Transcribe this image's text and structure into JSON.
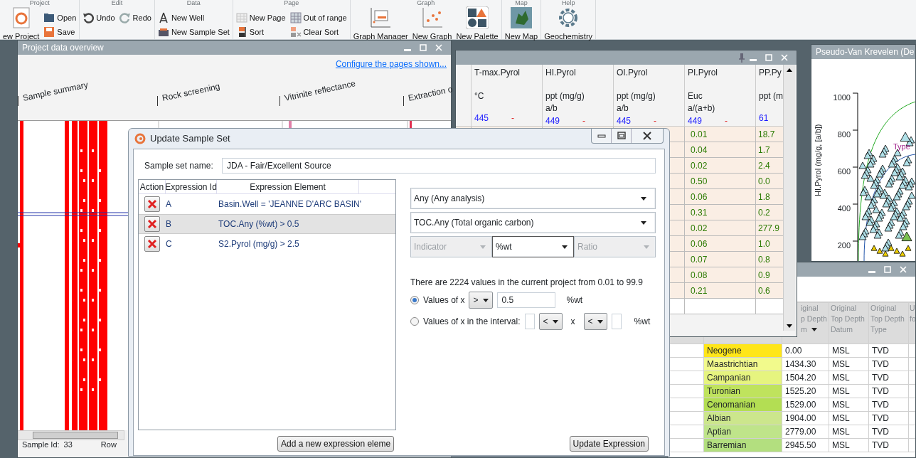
{
  "ribbon": {
    "groups": [
      {
        "label": "Project",
        "columns": [
          [
            {
              "label": "ew Project",
              "kind": "large"
            }
          ],
          [
            {
              "label": "Open",
              "kind": "small"
            },
            {
              "label": "Save",
              "kind": "small"
            }
          ]
        ]
      },
      {
        "label": "Edit",
        "columns": [
          [
            {
              "label": "Undo",
              "kind": "small"
            }
          ],
          [
            {
              "label": "Redo",
              "kind": "small"
            }
          ]
        ]
      },
      {
        "label": "Data",
        "columns": [
          [
            {
              "label": "New Well",
              "kind": "small"
            },
            {
              "label": "New Sample Set",
              "kind": "small"
            }
          ]
        ]
      },
      {
        "label": "Page",
        "columns": [
          [
            {
              "label": "New Page",
              "kind": "small"
            },
            {
              "label": "Sort",
              "kind": "small"
            }
          ],
          [
            {
              "label": "Out of range",
              "kind": "small"
            },
            {
              "label": "Clear Sort",
              "kind": "small"
            }
          ]
        ]
      },
      {
        "label": "Graph",
        "columns": [
          [
            {
              "label": "Graph Manager",
              "kind": "large"
            }
          ],
          [
            {
              "label": "New Graph",
              "kind": "large"
            }
          ],
          [
            {
              "label": "New Palette",
              "kind": "large"
            }
          ]
        ]
      },
      {
        "label": "Map",
        "columns": [
          [
            {
              "label": "New Map",
              "kind": "large"
            }
          ]
        ]
      },
      {
        "label": "Help",
        "columns": [
          [
            {
              "label": "Geochemistry",
              "kind": "large"
            }
          ]
        ]
      }
    ]
  },
  "overview_window": {
    "title": "Project data overview",
    "link": "Configure the pages shown...",
    "pages": [
      "Sample summary",
      "Rock screening",
      "Vitrinite reflectance",
      "Extraction o"
    ],
    "status": [
      "Sample Id:",
      "33",
      "Row"
    ]
  },
  "grid_window": {
    "columns": [
      {
        "name": "T-max.Pyrol",
        "units": [
          "°C"
        ],
        "value": "445",
        "marker": "-"
      },
      {
        "name": "HI.Pyrol",
        "units": [
          "ppt (mg/g)",
          "a/b"
        ],
        "value": "449",
        "marker": "-"
      },
      {
        "name": "OI.Pyrol",
        "units": [
          "ppt (mg/g)",
          "a/b"
        ],
        "value": "445",
        "marker": "-"
      },
      {
        "name": "PI.Pyrol",
        "units": [
          "Euc",
          "a/(a+b)"
        ],
        "value": "449",
        "marker": "-"
      },
      {
        "name": "PP.Py",
        "units": [
          "ppt (m"
        ],
        "value": "61"
      }
    ],
    "rows": [
      {
        "values": [
          "0.01",
          "18.7"
        ]
      },
      {
        "values": [
          "0.04",
          "1.7"
        ]
      },
      {
        "values": [
          "0.02",
          "2.4"
        ]
      },
      {
        "values": [
          "0.50",
          "0.0"
        ]
      },
      {
        "values": [
          "0.06",
          "1.8"
        ]
      },
      {
        "values": [
          "0.31",
          "0.2"
        ]
      },
      {
        "values": [
          "0.02",
          "277.9"
        ]
      },
      {
        "values": [
          "0.06",
          "1.0"
        ]
      },
      {
        "values": [
          "0.07",
          "0.8"
        ]
      },
      {
        "values": [
          "0.08",
          "0.9"
        ]
      },
      {
        "values": [
          "0.21",
          "0.6"
        ]
      },
      {
        "values": []
      }
    ]
  },
  "chart_window": {
    "title": "Pseudo-Van Krevelen (De",
    "ylabel": "HI.Pyrol (mg/g, [a/b])",
    "yticks": [
      "1000",
      "800",
      "600",
      "400",
      "200"
    ],
    "annotation": "Type"
  },
  "stratigraphy_window": {
    "columns": [
      {
        "lines": [
          "iginal",
          "p Depth",
          "m"
        ],
        "sorted": true
      },
      {
        "lines": [
          "Original",
          "Top Depth",
          "Datum"
        ],
        "sorted": false
      },
      {
        "lines": [
          "Original",
          "Top Depth",
          "Type"
        ],
        "sorted": false
      },
      {
        "lines": [
          "U",
          "fo"
        ],
        "sorted": false
      }
    ],
    "rows": [
      {
        "stage": "Neogene",
        "color": "#ffe619",
        "depth": "0.00",
        "datum": "MSL",
        "type": "TVD"
      },
      {
        "stage": "Maastrichtian",
        "color": "#f2fa8c",
        "depth": "1434.30",
        "datum": "MSL",
        "type": "TVD"
      },
      {
        "stage": "Campanian",
        "color": "#e6f47f",
        "depth": "1504.20",
        "datum": "MSL",
        "type": "TVD"
      },
      {
        "stage": "Turonian",
        "color": "#bfe35d",
        "depth": "1525.20",
        "datum": "MSL",
        "type": "TVD"
      },
      {
        "stage": "Cenomanian",
        "color": "#b3de53",
        "depth": "1529.00",
        "datum": "MSL",
        "type": "TVD"
      },
      {
        "stage": "Albian",
        "color": "#cce68c",
        "depth": "1904.00",
        "datum": "MSL",
        "type": "TVD"
      },
      {
        "stage": "Aptian",
        "color": "#bfe48a",
        "depth": "2779.00",
        "datum": "MSL",
        "type": "TVD"
      },
      {
        "stage": "Barremian",
        "color": "#b3df7f",
        "depth": "2945.50",
        "datum": "MSL",
        "type": "TVD"
      }
    ]
  },
  "dialog": {
    "title": "Update Sample Set",
    "name_label": "Sample set name:",
    "name_value": "JDA - Fair/Excellent Source",
    "expressions": {
      "columns": [
        "Action",
        "Expression Id",
        "Expression Element"
      ],
      "rows": [
        {
          "id": "A",
          "element": "Basin.Well = 'JEANNE D'ARC BASIN'",
          "selected": false
        },
        {
          "id": "B",
          "element": "TOC.Any (%wt) > 0.5",
          "selected": true
        },
        {
          "id": "C",
          "element": "S2.Pyrol (mg/g) > 2.5",
          "selected": false
        }
      ]
    },
    "analysis_select": "Any (Any analysis)",
    "parameter_select": "TOC.Any (Total organic carbon)",
    "unit_selects": [
      {
        "value": "Indicator",
        "disabled": true
      },
      {
        "value": "%wt",
        "disabled": false
      },
      {
        "value": "Ratio",
        "disabled": true
      }
    ],
    "info": "There are 2224 values in the current project from 0.01 to 99.9",
    "conditions": [
      {
        "kind": "single",
        "label": "Values of x",
        "selected": true,
        "operator": ">",
        "value": "0.5",
        "unit": "%wt"
      },
      {
        "kind": "interval",
        "label": "Values of x in the interval:",
        "selected": false,
        "operators": [
          "<",
          "<"
        ],
        "variable": "x",
        "unit": "%wt"
      }
    ],
    "add_button": "Add a new expression eleme",
    "update_button": "Update Expression"
  }
}
